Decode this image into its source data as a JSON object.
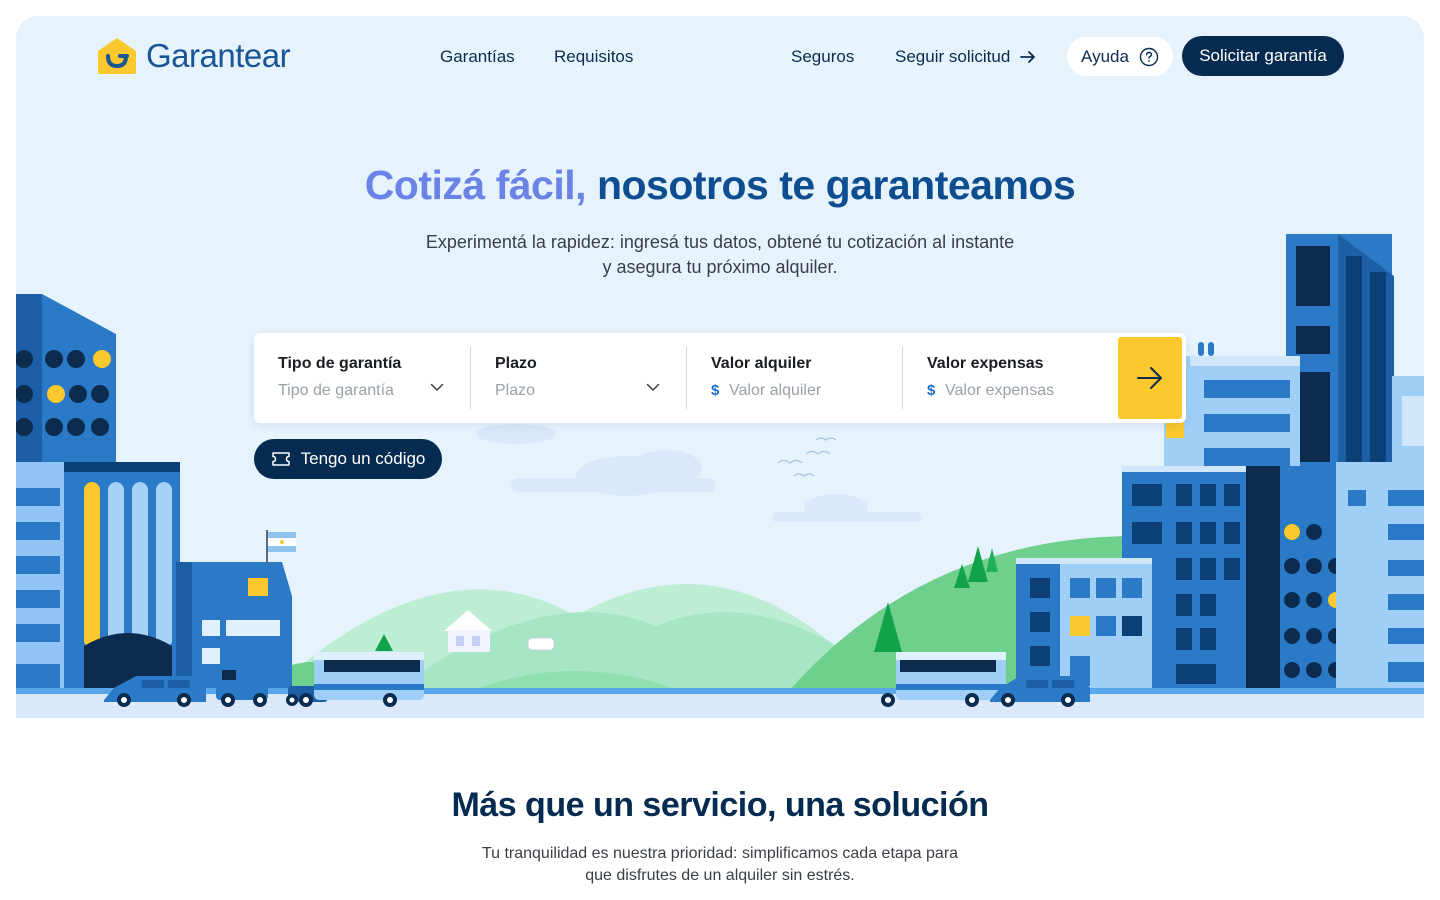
{
  "brand": {
    "name": "Garantear"
  },
  "nav": {
    "links": [
      "Garantías",
      "Requisitos",
      "Seguros"
    ],
    "follow_label": "Seguir solicitud",
    "help_label": "Ayuda",
    "cta_label": "Solicitar garantía"
  },
  "hero": {
    "title_accent": "Cotizá fácil,",
    "title_main": "nosotros te garanteamos",
    "subtitle": "Experimentá la rapidez: ingresá tus datos, obtené tu cotización al instante y asegura tu próximo alquiler."
  },
  "quote_form": {
    "fields": [
      {
        "label": "Tipo de garantía",
        "placeholder": "Tipo de garantía"
      },
      {
        "label": "Plazo",
        "placeholder": "Plazo"
      },
      {
        "label": "Valor alquiler",
        "placeholder": "Valor alquiler",
        "currency": "$"
      },
      {
        "label": "Valor expensas",
        "placeholder": "Valor expensas",
        "currency": "$"
      }
    ]
  },
  "code_button": {
    "label": "Tengo un código"
  },
  "section": {
    "title": "Más que un servicio, una solución",
    "subtitle": "Tu tranquilidad es nuestra prioridad: simplificamos cada etapa para que disfrutes de un alquiler sin estrés."
  },
  "colors": {
    "navy": "#062b50",
    "brand_blue": "#1a5596",
    "accent_violet": "#6b83e6",
    "yellow": "#fbc82d",
    "hero_bg": "#e6f3fd"
  }
}
